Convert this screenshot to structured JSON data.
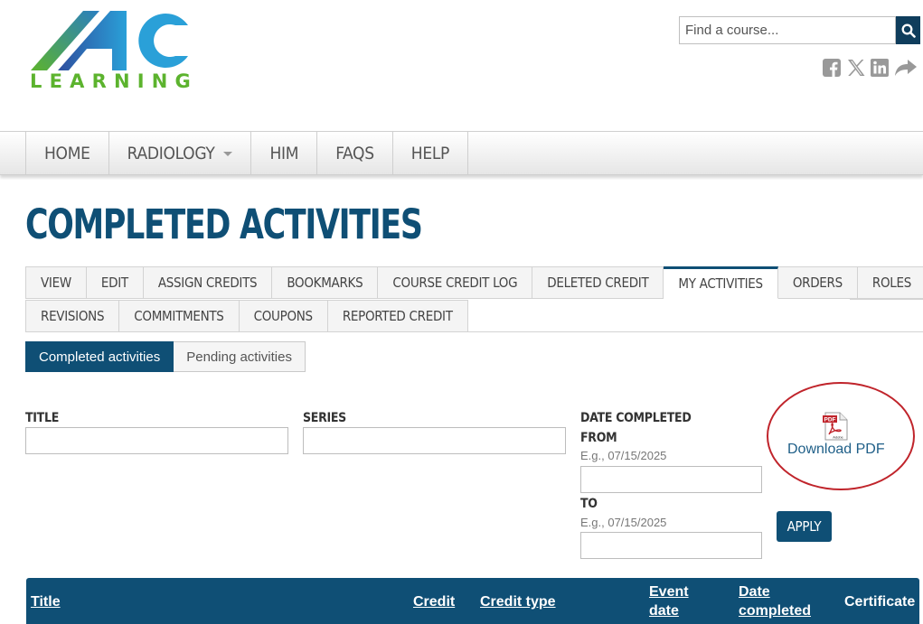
{
  "brand": {
    "logo_letters": "AHC",
    "logo_word": "LEARNING"
  },
  "search": {
    "placeholder": "Find a course..."
  },
  "social_icons": [
    "facebook-icon",
    "x-twitter-icon",
    "linkedin-icon",
    "share-icon"
  ],
  "nav": {
    "items": [
      {
        "label": "HOME"
      },
      {
        "label": "RADIOLOGY",
        "has_dropdown": true
      },
      {
        "label": "HIM"
      },
      {
        "label": "FAQS"
      },
      {
        "label": "HELP"
      }
    ]
  },
  "page": {
    "title": "COMPLETED ACTIVITIES"
  },
  "tabs": {
    "row1": [
      "VIEW",
      "EDIT",
      "ASSIGN CREDITS",
      "BOOKMARKS",
      "COURSE CREDIT LOG",
      "DELETED CREDIT",
      "MY ACTIVITIES",
      "ORDERS",
      "ROLES"
    ],
    "row2": [
      "REVISIONS",
      "COMMITMENTS",
      "COUPONS",
      "REPORTED CREDIT"
    ],
    "active": "MY ACTIVITIES"
  },
  "subtabs": {
    "active": "Completed activities",
    "inactive": "Pending activities"
  },
  "filters": {
    "title_label": "TITLE",
    "series_label": "SERIES",
    "date_label": "DATE COMPLETED",
    "from_label": "FROM",
    "to_label": "TO",
    "date_hint": "E.g., 07/15/2025",
    "apply_label": "APPLY"
  },
  "download": {
    "label": "Download PDF",
    "icon_text": "PDF",
    "icon_brand": "Adobe"
  },
  "table": {
    "headers": {
      "title": "Title",
      "credit": "Credit",
      "credit_type": "Credit type",
      "event_date_1": "Event",
      "event_date_2": "date",
      "date_completed_1": "Date",
      "date_completed_2": "completed",
      "certificate": "Certificate"
    }
  },
  "colors": {
    "primary": "#0f4f75",
    "accent_green": "#5cb32e",
    "highlight_circle": "#c0242b"
  }
}
